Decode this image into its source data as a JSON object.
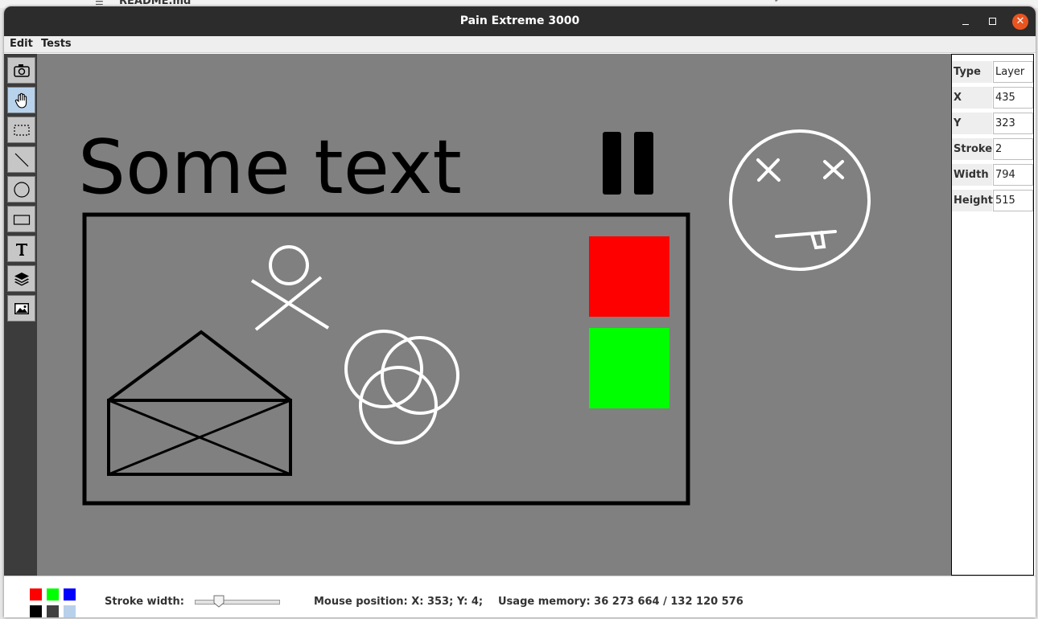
{
  "background": {
    "filename": "README.md"
  },
  "window": {
    "title": "Pain Extreme 3000"
  },
  "menu": [
    {
      "label": "Edit"
    },
    {
      "label": "Tests"
    }
  ],
  "tools": [
    {
      "icon": "camera-icon"
    },
    {
      "icon": "hand-icon",
      "active": true
    },
    {
      "icon": "selection-icon"
    },
    {
      "icon": "line-icon"
    },
    {
      "icon": "ellipse-icon"
    },
    {
      "icon": "rectangle-icon"
    },
    {
      "icon": "text-icon"
    },
    {
      "icon": "layers-icon"
    },
    {
      "icon": "image-icon"
    }
  ],
  "canvas": {
    "background": "#808080",
    "text": "Some text",
    "colors": {
      "red": "#ff0000",
      "green": "#00ff00"
    }
  },
  "properties": {
    "type": {
      "label": "Type",
      "value": "Layer"
    },
    "x": {
      "label": "X",
      "value": "435"
    },
    "y": {
      "label": "Y",
      "value": "323"
    },
    "stroke": {
      "label": "Stroke",
      "value": "2"
    },
    "width": {
      "label": "Width",
      "value": "794"
    },
    "height": {
      "label": "Height",
      "value": "515"
    }
  },
  "status": {
    "palette": [
      "#ff0000",
      "#00ff00",
      "#0000ff",
      "#000000",
      "#404040",
      "#b8d0ea"
    ],
    "stroke_label": "Stroke width:",
    "mouse_position": "Mouse position: X: 353; Y: 4;",
    "memory": "Usage memory: 36 273 664 / 132 120 576"
  }
}
